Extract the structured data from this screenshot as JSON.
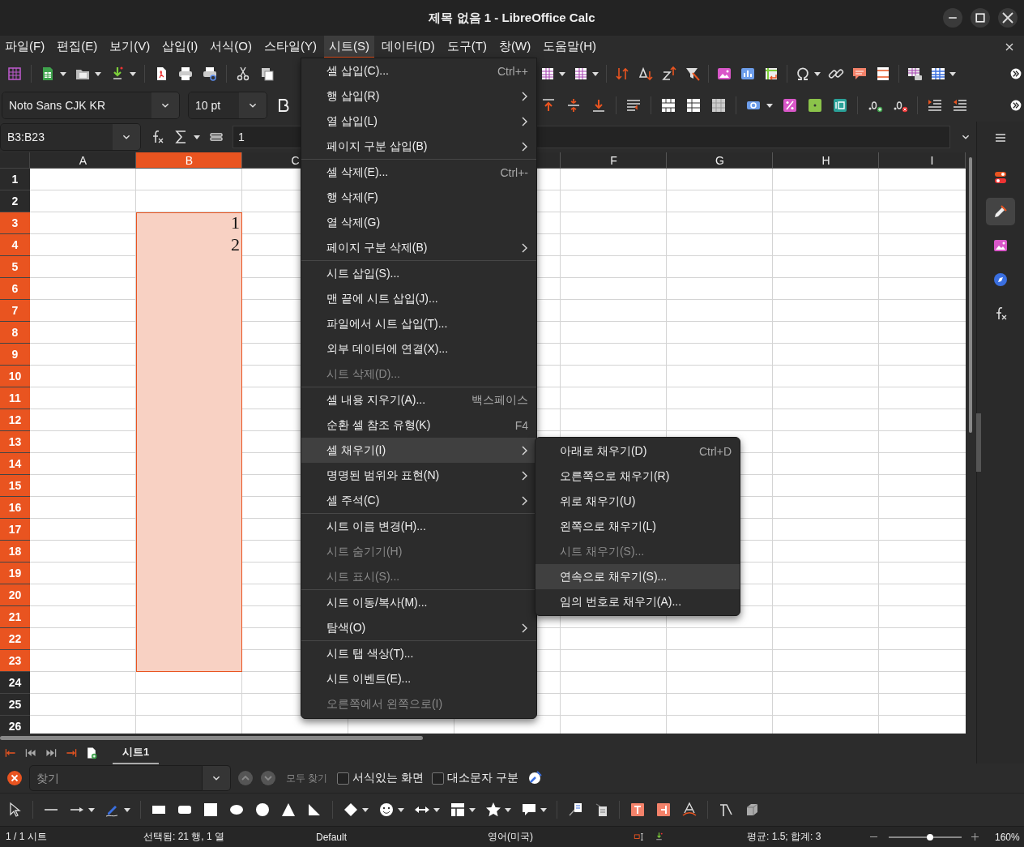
{
  "window": {
    "title": "제목 없음 1 - LibreOffice Calc"
  },
  "menubar": [
    {
      "label": "파일(F)",
      "selected": false
    },
    {
      "label": "편집(E)",
      "selected": false
    },
    {
      "label": "보기(V)",
      "selected": false
    },
    {
      "label": "삽입(I)",
      "selected": false
    },
    {
      "label": "서식(O)",
      "selected": false
    },
    {
      "label": "스타일(Y)",
      "selected": false
    },
    {
      "label": "시트(S)",
      "selected": true
    },
    {
      "label": "데이터(D)",
      "selected": false
    },
    {
      "label": "도구(T)",
      "selected": false
    },
    {
      "label": "창(W)",
      "selected": false
    },
    {
      "label": "도움말(H)",
      "selected": false
    }
  ],
  "sheet_menu": {
    "groups": [
      [
        {
          "label": "셀 삽입(C)...",
          "shortcut": "Ctrl++",
          "submenu": false,
          "disabled": false,
          "selected": false
        },
        {
          "label": "행 삽입(R)",
          "submenu": true,
          "disabled": false,
          "selected": false
        },
        {
          "label": "열 삽입(L)",
          "submenu": true,
          "disabled": false,
          "selected": false
        },
        {
          "label": "페이지 구분 삽입(B)",
          "submenu": true,
          "disabled": false,
          "selected": false
        }
      ],
      [
        {
          "label": "셀 삭제(E)...",
          "shortcut": "Ctrl+-",
          "submenu": false,
          "disabled": false,
          "selected": false
        },
        {
          "label": "행 삭제(F)",
          "submenu": false,
          "disabled": false,
          "selected": false
        },
        {
          "label": "열 삭제(G)",
          "submenu": false,
          "disabled": false,
          "selected": false
        },
        {
          "label": "페이지 구분 삭제(B)",
          "submenu": true,
          "disabled": false,
          "selected": false
        }
      ],
      [
        {
          "label": "시트 삽입(S)...",
          "submenu": false,
          "disabled": false,
          "selected": false
        },
        {
          "label": "맨 끝에 시트 삽입(J)...",
          "submenu": false,
          "disabled": false,
          "selected": false
        },
        {
          "label": "파일에서 시트 삽입(T)...",
          "submenu": false,
          "disabled": false,
          "selected": false
        },
        {
          "label": "외부 데이터에 연결(X)...",
          "submenu": false,
          "disabled": false,
          "selected": false
        },
        {
          "label": "시트 삭제(D)...",
          "submenu": false,
          "disabled": true,
          "selected": false
        }
      ],
      [
        {
          "label": "셀 내용 지우기(A)...",
          "shortcut": "백스페이스",
          "submenu": false,
          "disabled": false,
          "selected": false
        },
        {
          "label": "순환 셀 참조 유형(K)",
          "shortcut": "F4",
          "submenu": false,
          "disabled": false,
          "selected": false
        },
        {
          "label": "셀 채우기(I)",
          "submenu": true,
          "disabled": false,
          "selected": true,
          "children": [
            {
              "label": "아래로 채우기(D)",
              "shortcut": "Ctrl+D",
              "disabled": false,
              "selected": false
            },
            {
              "label": "오른쪽으로 채우기(R)",
              "disabled": false,
              "selected": false
            },
            {
              "label": "위로 채우기(U)",
              "disabled": false,
              "selected": false
            },
            {
              "label": "왼쪽으로 채우기(L)",
              "disabled": false,
              "selected": false
            },
            {
              "label": "시트 채우기(S)...",
              "disabled": true,
              "selected": false
            },
            {
              "label": "연속으로 채우기(S)...",
              "disabled": false,
              "selected": true
            },
            {
              "label": "임의 번호로 채우기(A)...",
              "disabled": false,
              "selected": false
            }
          ]
        },
        {
          "label": "명명된 범위와 표현(N)",
          "submenu": true,
          "disabled": false,
          "selected": false
        },
        {
          "label": "셀 주석(C)",
          "submenu": true,
          "disabled": false,
          "selected": false
        }
      ],
      [
        {
          "label": "시트 이름 변경(H)...",
          "submenu": false,
          "disabled": false,
          "selected": false
        },
        {
          "label": "시트 숨기기(H)",
          "submenu": false,
          "disabled": true,
          "selected": false
        },
        {
          "label": "시트 표시(S)...",
          "submenu": false,
          "disabled": true,
          "selected": false
        }
      ],
      [
        {
          "label": "시트 이동/복사(M)...",
          "submenu": false,
          "disabled": false,
          "selected": false
        },
        {
          "label": "탐색(O)",
          "submenu": true,
          "disabled": false,
          "selected": false
        }
      ],
      [
        {
          "label": "시트 탭 색상(T)...",
          "submenu": false,
          "disabled": false,
          "selected": false
        },
        {
          "label": "시트 이벤트(E)...",
          "submenu": false,
          "disabled": false,
          "selected": false
        },
        {
          "label": "오른쪽에서 왼쪽으로(I)",
          "submenu": false,
          "disabled": true,
          "selected": false
        }
      ]
    ]
  },
  "font_name": {
    "value": "Noto Sans CJK KR"
  },
  "font_size": {
    "value": "10 pt"
  },
  "name_box": {
    "value": "B3:B23"
  },
  "formula": {
    "value": "1"
  },
  "sheet": {
    "columns": [
      {
        "label": "A",
        "selected": false
      },
      {
        "label": "B",
        "selected": true
      },
      {
        "label": "C",
        "selected": false
      },
      {
        "label": "F",
        "selected": false
      },
      {
        "label": "G",
        "selected": false
      },
      {
        "label": "H",
        "selected": false
      },
      {
        "label": "I",
        "selected": false
      }
    ],
    "rows": [
      {
        "label": "1",
        "selected": false
      },
      {
        "label": "2",
        "selected": false
      },
      {
        "label": "3",
        "selected": true,
        "cells": [
          null,
          "1"
        ]
      },
      {
        "label": "4",
        "selected": true,
        "cells": [
          null,
          "2"
        ]
      },
      {
        "label": "5",
        "selected": true
      },
      {
        "label": "6",
        "selected": true
      },
      {
        "label": "7",
        "selected": true
      },
      {
        "label": "8",
        "selected": true
      },
      {
        "label": "9",
        "selected": true
      },
      {
        "label": "10",
        "selected": true
      },
      {
        "label": "11",
        "selected": true
      },
      {
        "label": "12",
        "selected": true
      },
      {
        "label": "13",
        "selected": true
      },
      {
        "label": "14",
        "selected": true
      },
      {
        "label": "15",
        "selected": true
      },
      {
        "label": "16",
        "selected": true
      },
      {
        "label": "17",
        "selected": true
      },
      {
        "label": "18",
        "selected": true
      },
      {
        "label": "19",
        "selected": true
      },
      {
        "label": "20",
        "selected": true
      },
      {
        "label": "21",
        "selected": true
      },
      {
        "label": "22",
        "selected": true
      },
      {
        "label": "23",
        "selected": true
      },
      {
        "label": "24",
        "selected": false
      },
      {
        "label": "25",
        "selected": false
      },
      {
        "label": "26",
        "selected": false
      }
    ]
  },
  "sheet_tabs": [
    {
      "label": "시트1",
      "selected": true
    }
  ],
  "find_bar": {
    "placeholder": "찾기",
    "find_all": {
      "label": "모두 찾기",
      "disabled": true
    },
    "options": [
      {
        "label": "서식있는 화면",
        "checked": false
      },
      {
        "label": "대소문자 구분",
        "checked": false
      }
    ]
  },
  "status_bar": {
    "sheet": "1 / 1 시트",
    "selection": "선택됨: 21 행, 1 열",
    "page_style": "Default",
    "language": "영어(미국)",
    "summary": "평균: 1.5; 합계: 3",
    "zoom": {
      "level": 0.57,
      "reading": "160%"
    }
  }
}
